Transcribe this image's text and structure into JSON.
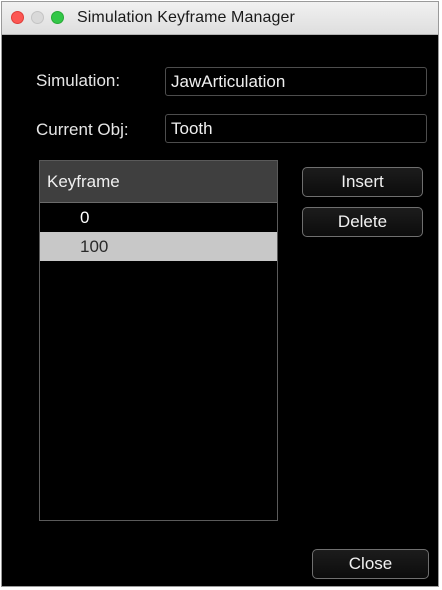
{
  "window": {
    "title": "Simulation Keyframe Manager"
  },
  "form": {
    "simulation_label": "Simulation:",
    "simulation_value": "JawArticulation",
    "current_obj_label": "Current Obj:",
    "current_obj_value": "Tooth"
  },
  "table": {
    "column_header": "Keyframe",
    "rows": [
      "0",
      "100"
    ],
    "selected_index": 1
  },
  "buttons": {
    "insert": "Insert",
    "delete": "Delete",
    "close": "Close"
  },
  "colors": {
    "background": "#000000",
    "header_bg": "#3f3f3f",
    "selected_row": "#c8c8c8",
    "close_light": "#fc5753",
    "max_light": "#33c748"
  }
}
